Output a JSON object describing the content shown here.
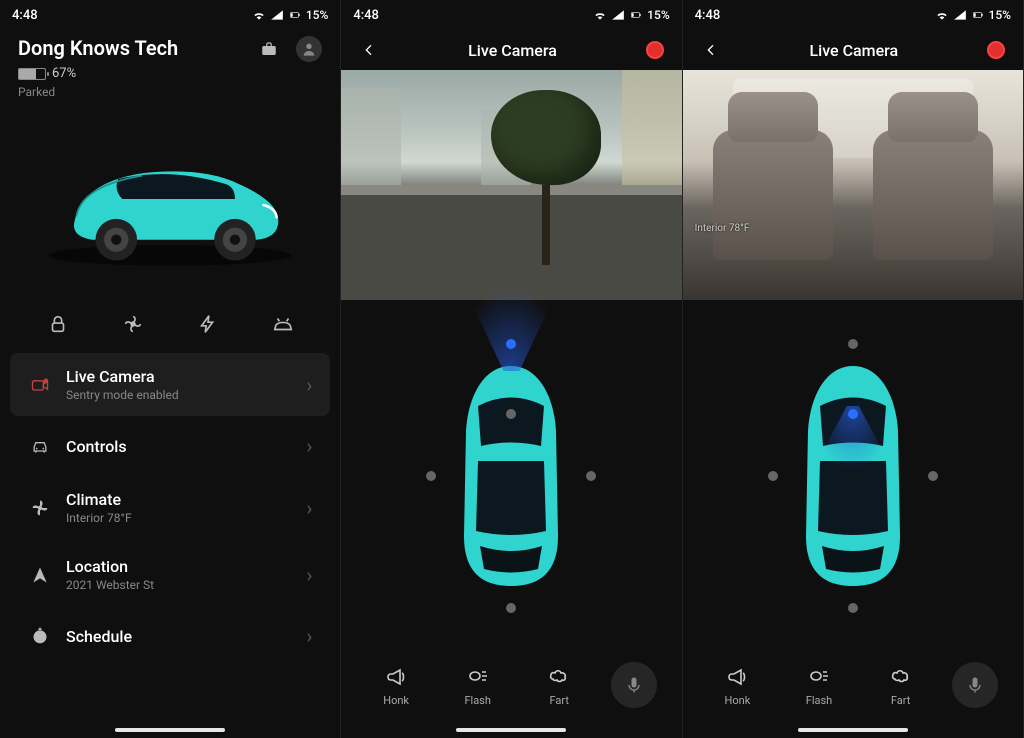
{
  "status": {
    "time": "4:48",
    "battery": "15%"
  },
  "home": {
    "vehicle_name": "Dong Knows Tech",
    "battery_pct": "67%",
    "state": "Parked",
    "menu": {
      "live_camera": {
        "title": "Live Camera",
        "sub": "Sentry mode enabled"
      },
      "controls": {
        "title": "Controls"
      },
      "climate": {
        "title": "Climate",
        "sub": "Interior 78°F"
      },
      "location": {
        "title": "Location",
        "sub": "2021 Webster St"
      },
      "schedule": {
        "title": "Schedule"
      }
    }
  },
  "live": {
    "title": "Live Camera",
    "interior_temp": "Interior 78°F",
    "actions": {
      "honk": "Honk",
      "flash": "Flash",
      "fart": "Fart"
    }
  }
}
